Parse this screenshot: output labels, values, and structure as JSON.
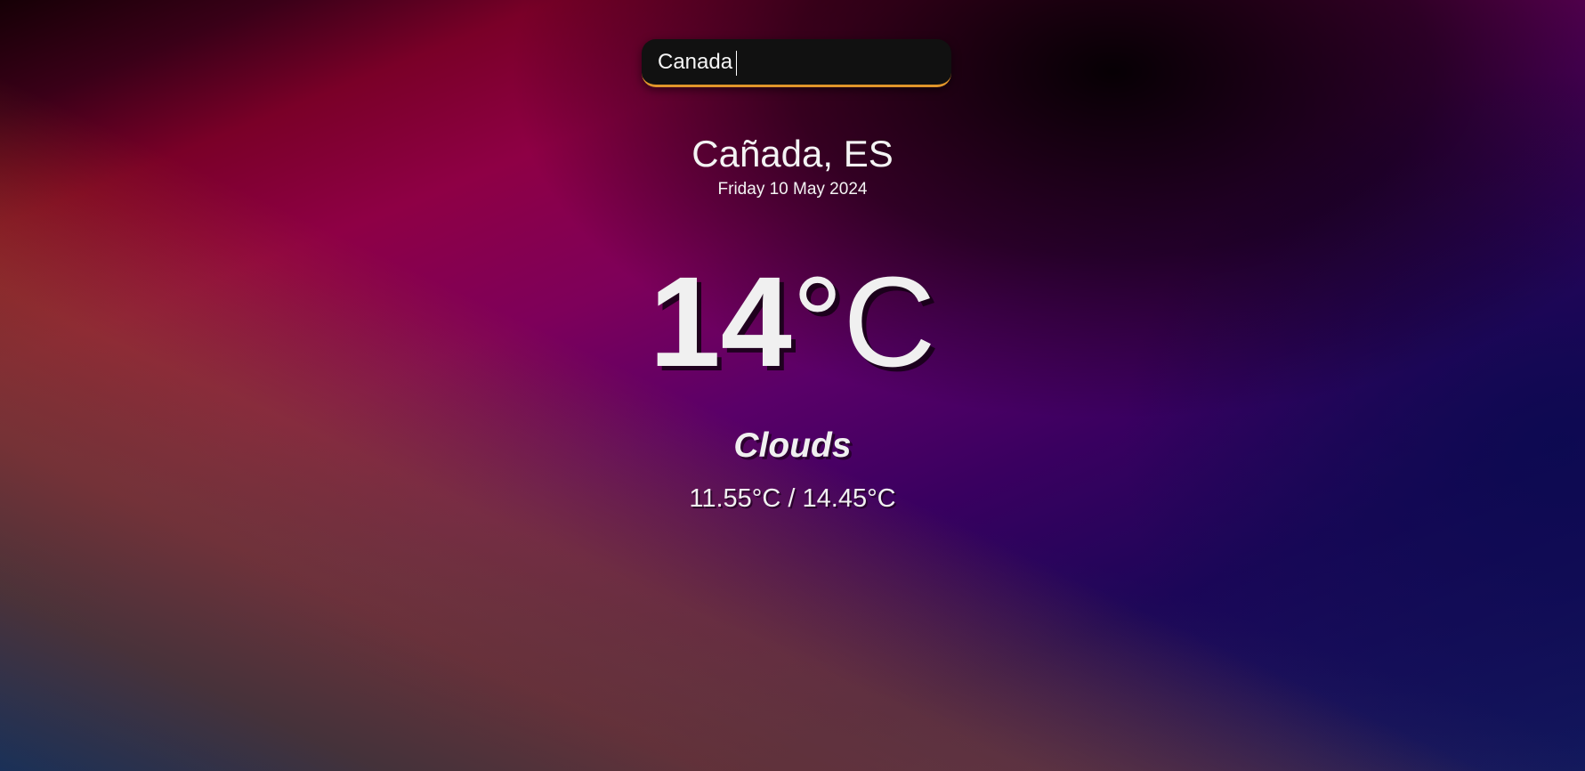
{
  "search": {
    "value": "Canada",
    "accent_color": "#e0952a"
  },
  "location": {
    "name": "Cañada, ES",
    "date": "Friday 10 May 2024"
  },
  "current": {
    "temperature_value": "14",
    "temperature_unit": "°C",
    "condition": "Clouds",
    "min_max": "11.55°C / 14.45°C"
  }
}
